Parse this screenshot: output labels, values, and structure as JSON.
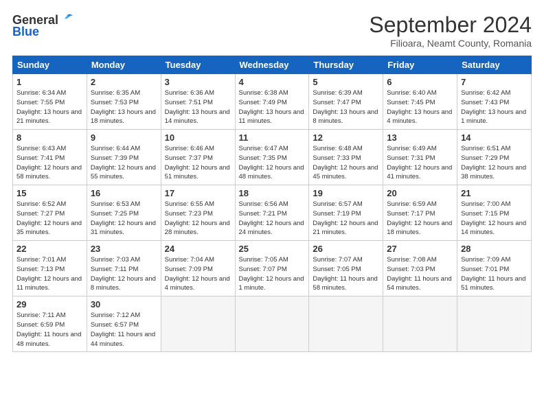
{
  "header": {
    "logo_general": "General",
    "logo_blue": "Blue",
    "title": "September 2024",
    "subtitle": "Filioara, Neamt County, Romania"
  },
  "days_of_week": [
    "Sunday",
    "Monday",
    "Tuesday",
    "Wednesday",
    "Thursday",
    "Friday",
    "Saturday"
  ],
  "weeks": [
    [
      {
        "num": "1",
        "rise": "6:34 AM",
        "set": "7:55 PM",
        "daylight": "13 hours and 21 minutes."
      },
      {
        "num": "2",
        "rise": "6:35 AM",
        "set": "7:53 PM",
        "daylight": "13 hours and 18 minutes."
      },
      {
        "num": "3",
        "rise": "6:36 AM",
        "set": "7:51 PM",
        "daylight": "13 hours and 14 minutes."
      },
      {
        "num": "4",
        "rise": "6:38 AM",
        "set": "7:49 PM",
        "daylight": "13 hours and 11 minutes."
      },
      {
        "num": "5",
        "rise": "6:39 AM",
        "set": "7:47 PM",
        "daylight": "13 hours and 8 minutes."
      },
      {
        "num": "6",
        "rise": "6:40 AM",
        "set": "7:45 PM",
        "daylight": "13 hours and 4 minutes."
      },
      {
        "num": "7",
        "rise": "6:42 AM",
        "set": "7:43 PM",
        "daylight": "13 hours and 1 minute."
      }
    ],
    [
      {
        "num": "8",
        "rise": "6:43 AM",
        "set": "7:41 PM",
        "daylight": "12 hours and 58 minutes."
      },
      {
        "num": "9",
        "rise": "6:44 AM",
        "set": "7:39 PM",
        "daylight": "12 hours and 55 minutes."
      },
      {
        "num": "10",
        "rise": "6:46 AM",
        "set": "7:37 PM",
        "daylight": "12 hours and 51 minutes."
      },
      {
        "num": "11",
        "rise": "6:47 AM",
        "set": "7:35 PM",
        "daylight": "12 hours and 48 minutes."
      },
      {
        "num": "12",
        "rise": "6:48 AM",
        "set": "7:33 PM",
        "daylight": "12 hours and 45 minutes."
      },
      {
        "num": "13",
        "rise": "6:49 AM",
        "set": "7:31 PM",
        "daylight": "12 hours and 41 minutes."
      },
      {
        "num": "14",
        "rise": "6:51 AM",
        "set": "7:29 PM",
        "daylight": "12 hours and 38 minutes."
      }
    ],
    [
      {
        "num": "15",
        "rise": "6:52 AM",
        "set": "7:27 PM",
        "daylight": "12 hours and 35 minutes."
      },
      {
        "num": "16",
        "rise": "6:53 AM",
        "set": "7:25 PM",
        "daylight": "12 hours and 31 minutes."
      },
      {
        "num": "17",
        "rise": "6:55 AM",
        "set": "7:23 PM",
        "daylight": "12 hours and 28 minutes."
      },
      {
        "num": "18",
        "rise": "6:56 AM",
        "set": "7:21 PM",
        "daylight": "12 hours and 24 minutes."
      },
      {
        "num": "19",
        "rise": "6:57 AM",
        "set": "7:19 PM",
        "daylight": "12 hours and 21 minutes."
      },
      {
        "num": "20",
        "rise": "6:59 AM",
        "set": "7:17 PM",
        "daylight": "12 hours and 18 minutes."
      },
      {
        "num": "21",
        "rise": "7:00 AM",
        "set": "7:15 PM",
        "daylight": "12 hours and 14 minutes."
      }
    ],
    [
      {
        "num": "22",
        "rise": "7:01 AM",
        "set": "7:13 PM",
        "daylight": "12 hours and 11 minutes."
      },
      {
        "num": "23",
        "rise": "7:03 AM",
        "set": "7:11 PM",
        "daylight": "12 hours and 8 minutes."
      },
      {
        "num": "24",
        "rise": "7:04 AM",
        "set": "7:09 PM",
        "daylight": "12 hours and 4 minutes."
      },
      {
        "num": "25",
        "rise": "7:05 AM",
        "set": "7:07 PM",
        "daylight": "12 hours and 1 minute."
      },
      {
        "num": "26",
        "rise": "7:07 AM",
        "set": "7:05 PM",
        "daylight": "11 hours and 58 minutes."
      },
      {
        "num": "27",
        "rise": "7:08 AM",
        "set": "7:03 PM",
        "daylight": "11 hours and 54 minutes."
      },
      {
        "num": "28",
        "rise": "7:09 AM",
        "set": "7:01 PM",
        "daylight": "11 hours and 51 minutes."
      }
    ],
    [
      {
        "num": "29",
        "rise": "7:11 AM",
        "set": "6:59 PM",
        "daylight": "11 hours and 48 minutes."
      },
      {
        "num": "30",
        "rise": "7:12 AM",
        "set": "6:57 PM",
        "daylight": "11 hours and 44 minutes."
      },
      null,
      null,
      null,
      null,
      null
    ]
  ]
}
